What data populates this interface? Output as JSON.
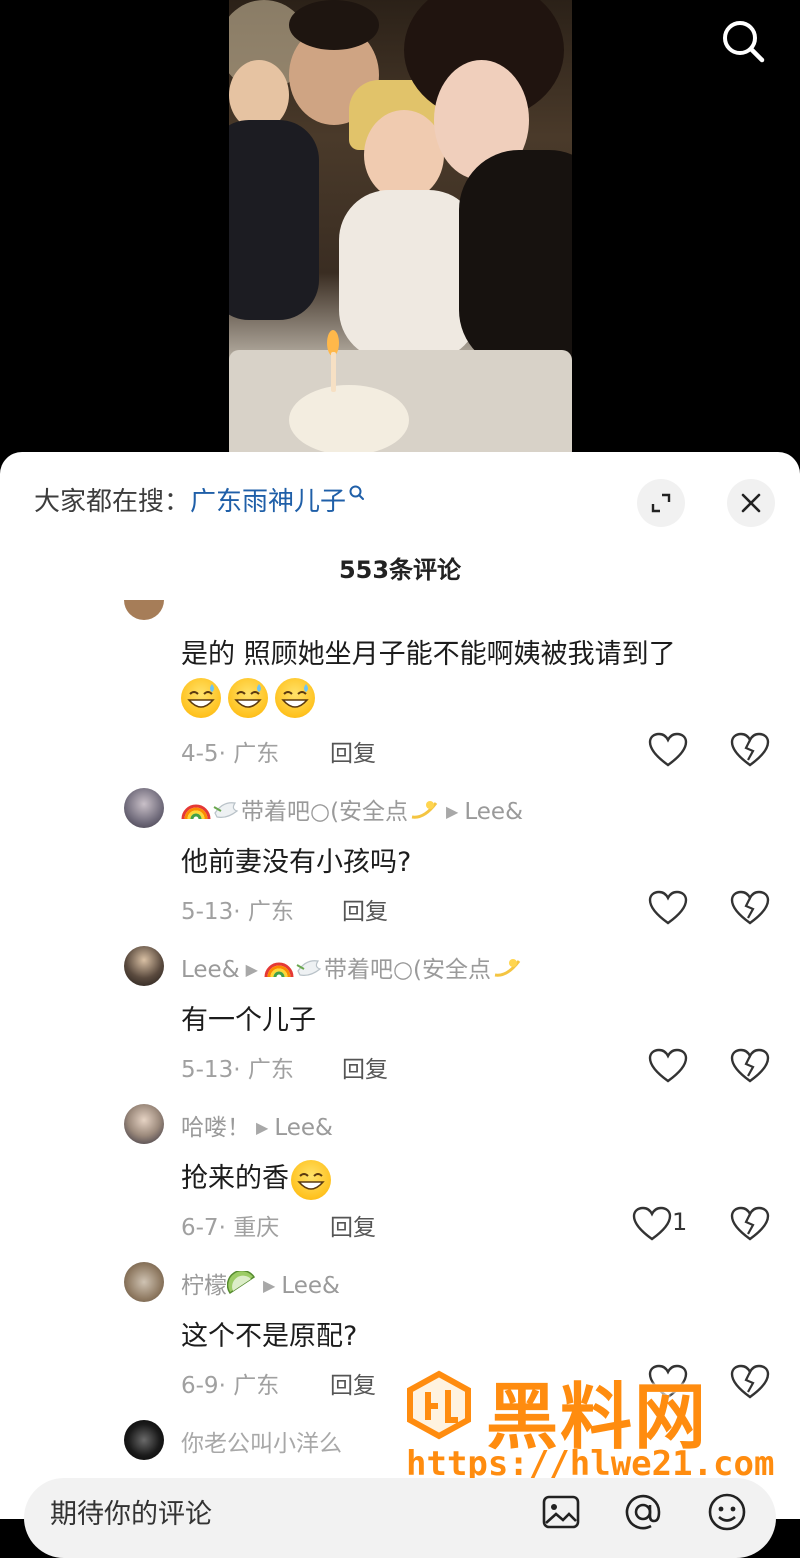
{
  "header": {
    "search_icon": "search-icon"
  },
  "trending": {
    "prefix": "大家都在搜：",
    "query": "广东雨神儿子",
    "query_icon": "search-small-icon",
    "link_color": "#1f5fa8"
  },
  "sheet": {
    "comment_count": "553条评论",
    "expand_icon": "expand-icon",
    "close_icon": "close-icon"
  },
  "comments": [
    {
      "text": "是的  照顾她坐月子能不能啊姨被我请到了",
      "emoji_line": [
        "grin-sweat-emoji",
        "grin-sweat-emoji",
        "grin-sweat-emoji"
      ],
      "date": "4-5",
      "location": "广东",
      "reply_label": "回复"
    },
    {
      "user": "带着吧○(安全点",
      "user_prefix_emoji": [
        "rainbow-emoji",
        "dove-emoji"
      ],
      "user_suffix_emoji": "dizzy-emoji",
      "reply_to": "Lee&",
      "text": "他前妻没有小孩吗?",
      "date": "5-13",
      "location": "广东",
      "reply_label": "回复"
    },
    {
      "user": "Lee&",
      "reply_to": "带着吧○(安全点",
      "reply_to_prefix_emoji": [
        "rainbow-emoji",
        "dove-emoji"
      ],
      "reply_to_suffix_emoji": "dizzy-emoji",
      "text": "有一个儿子",
      "date": "5-13",
      "location": "广东",
      "reply_label": "回复"
    },
    {
      "user": "哈喽！",
      "reply_to": "Lee&",
      "text": "抢来的香",
      "text_emoji": "grin-emoji",
      "date": "6-7",
      "location": "重庆",
      "reply_label": "回复",
      "likes": "1"
    },
    {
      "user": "柠檬",
      "user_suffix_emoji": "lime-emoji",
      "reply_to": "Lee&",
      "text": "这个不是原配?",
      "date": "6-9",
      "location": "广东",
      "reply_label": "回复"
    },
    {
      "text": "你老公叫小洋么"
    }
  ],
  "input": {
    "placeholder": "期待你的评论",
    "image_icon": "image-icon",
    "mention_icon": "at-icon",
    "emoji_icon": "emoji-face-icon"
  },
  "watermark": {
    "title": "黑料网",
    "url": "https://hlwe21.com",
    "color": "#ff8c0f"
  }
}
